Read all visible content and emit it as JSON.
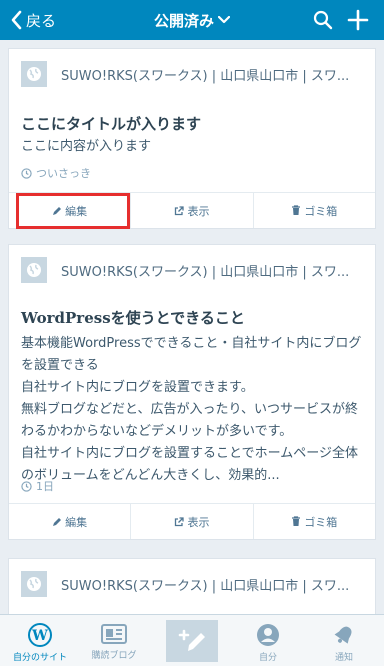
{
  "header": {
    "back_label": "戻る",
    "title": "公開済み",
    "search_icon": "search-icon",
    "add_icon": "plus-icon"
  },
  "posts": [
    {
      "site": "SUWO!RKS(スワークス) | 山口県山口市 | スワ...",
      "title": "ここにタイトルが入ります",
      "excerpt": [
        "ここに内容が入ります"
      ],
      "time": "ついさっき",
      "actions": {
        "edit": "編集",
        "view": "表示",
        "trash": "ゴミ箱"
      }
    },
    {
      "site": "SUWO!RKS(スワークス) | 山口県山口市 | スワ...",
      "title": "WordPressを使うとできること",
      "excerpt": [
        "基本機能WordPressでできること・自社サイト内にブログ",
        "を設置できる",
        "自社サイト内にブログを設置できます。",
        "無料ブログなどだと、広告が入ったり、いつサービスが終",
        "わるかわからないなどデメリットが多いです。",
        "自社サイト内にブログを設置することでホームページ全体",
        "のボリュームをどんどん大きくし、効果的..."
      ],
      "time": "1日",
      "actions": {
        "edit": "編集",
        "view": "表示",
        "trash": "ゴミ箱"
      }
    },
    {
      "site": "SUWO!RKS(スワークス) | 山口県山口市 | スワ..."
    }
  ],
  "tabbar": {
    "my_sites": "自分のサイト",
    "reader": "購読ブログ",
    "me": "自分",
    "notifications": "通知"
  },
  "colors": {
    "primary": "#0087be",
    "background": "#e9eef3",
    "highlight": "#e62e2e"
  }
}
